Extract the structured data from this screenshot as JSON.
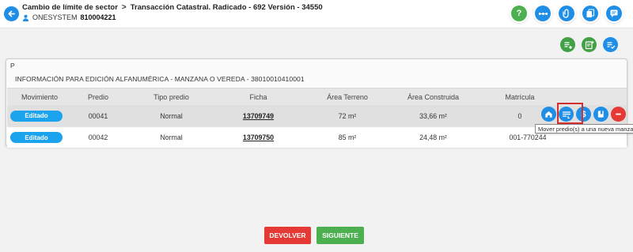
{
  "header": {
    "crumb_parent": "Cambio de límite de sector",
    "crumb_separator": ">",
    "crumb_current": "Transacción Catastral. Radicado - 692 Versión - 34550",
    "user_name": "ONESYSTEM",
    "user_id": "810004221",
    "icons": [
      "help-icon",
      "flow-icon",
      "attach-icon",
      "documents-icon",
      "comments-icon"
    ]
  },
  "actions": {
    "icons": [
      "add-list-icon",
      "add-note-icon",
      "checklist-icon"
    ]
  },
  "panel": {
    "letter": "P",
    "title": "INFORMACIÓN PARA EDICIÓN ALFANUMÉRICA - MANZANA O VEREDA - 38010010410001"
  },
  "table": {
    "headers": {
      "movimiento": "Movimiento",
      "predio": "Predio",
      "tipo": "Tipo predio",
      "ficha": "Ficha",
      "area_terreno": "Área Terreno",
      "area_construida": "Área Construida",
      "matricula": "Matrícula"
    },
    "rows": [
      {
        "movimiento": "Editado",
        "predio": "00041",
        "tipo": "Normal",
        "ficha": "13709749",
        "area_terreno": "72 m²",
        "area_construida": "33,66 m²",
        "matricula": "0"
      },
      {
        "movimiento": "Editado",
        "predio": "00042",
        "tipo": "Normal",
        "ficha": "13709750",
        "area_terreno": "85 m²",
        "area_construida": "24,48 m²",
        "matricula": "001-770244"
      }
    ]
  },
  "tooltip": "Mover predio(s) a una nueva manzana",
  "footer": {
    "devolver": "DEVOLVER",
    "siguiente": "SIGUIENTE"
  },
  "colors": {
    "primary": "#1f8ee6",
    "success": "#4caf50",
    "danger": "#e53935"
  }
}
